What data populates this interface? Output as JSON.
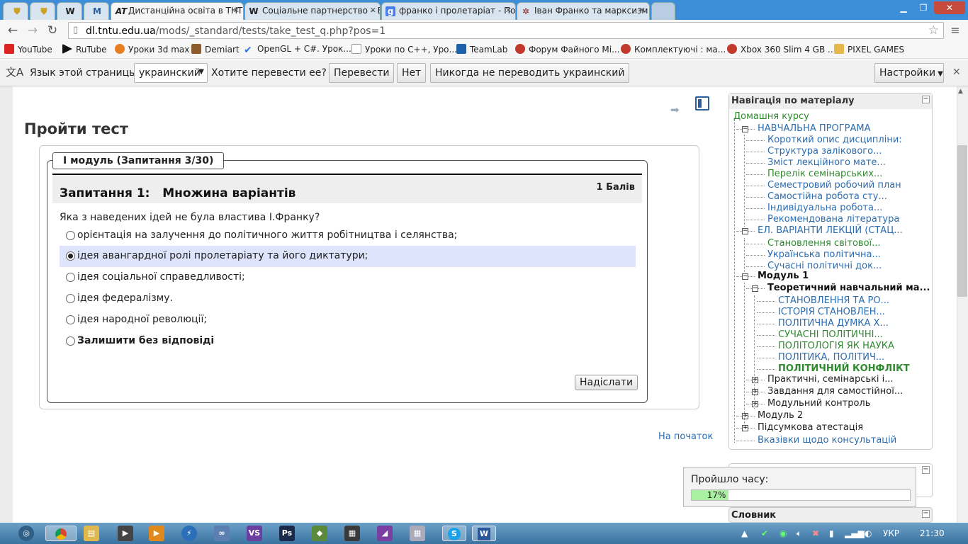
{
  "tabs": [
    {
      "title": "",
      "icon": "shield-icon"
    },
    {
      "title": "",
      "icon": "shield-icon"
    },
    {
      "title": "",
      "icon": "wikipedia-icon",
      "glyph": "W"
    },
    {
      "title": "",
      "icon": "moodle-icon",
      "glyph": "M"
    },
    {
      "title": "Дистанційна освіта в ТНТ",
      "icon": "at-icon",
      "glyph": "AT"
    },
    {
      "title": "Соціальне партнерство – Вік",
      "icon": "wikipedia-icon",
      "glyph": "W"
    },
    {
      "title": "франко і пролетаріат - Пошу",
      "icon": "google-icon",
      "glyph": "g"
    },
    {
      "title": "Іван Франко та марксизм",
      "icon": "star-icon",
      "glyph": "✲"
    }
  ],
  "address": {
    "domain": "dl.tntu.edu.ua",
    "path": "/mods/_standard/tests/take_test_q.php?pos=1"
  },
  "bookmarks": [
    {
      "label": "YouTube",
      "color": "#d22"
    },
    {
      "label": "RuTube",
      "color": "#111"
    },
    {
      "label": "Уроки 3d max",
      "color": "#e67e22"
    },
    {
      "label": "Demiart",
      "color": "#8e5b2a"
    },
    {
      "label": "OpenGL + C#. Урок...",
      "color": "#2a7ae2"
    },
    {
      "label": "Уроки по С++, Уро...",
      "color": "#bbb"
    },
    {
      "label": "TeamLab",
      "color": "#1d5fa8"
    },
    {
      "label": "Форум Файного Мі...",
      "color": "#c0392b"
    },
    {
      "label": "Комплектуючі : ма...",
      "color": "#c0392b"
    },
    {
      "label": "Xbox 360 Slim 4 GB ...",
      "color": "#c0392b"
    },
    {
      "label": "PIXEL GAMES",
      "color": "#e6b84a"
    }
  ],
  "translate": {
    "lang_label": "Язык этой страницы",
    "lang_value": "украинский",
    "question": "Хотите перевести ее?",
    "translate_btn": "Перевести",
    "no_btn": "Нет",
    "never_btn": "Никогда не переводить украинский",
    "settings_btn": "Настройки"
  },
  "page": {
    "title": "Пройти тест",
    "back_to_top": "На початок"
  },
  "test": {
    "legend": "І модуль (Запитання 3/30)",
    "question_title": "Запитання 1:   Множина варіантів",
    "grade": "1 Балів",
    "question_text": "Яка з наведених ідей не була властива І.Франку?",
    "options": [
      {
        "label": "орієнтація на залучення до політичного життя робітництва і селянства;",
        "selected": false
      },
      {
        "label": "ідея авангардної ролі пролетаріату та його диктатури;",
        "selected": true
      },
      {
        "label": "ідея соціальної справедливості;",
        "selected": false
      },
      {
        "label": "ідея федералізму.",
        "selected": false
      },
      {
        "label": "ідея народної революції;",
        "selected": false
      },
      {
        "label": "Залишити без відповіді",
        "selected": false,
        "bold": true
      }
    ],
    "submit": "Надіслати"
  },
  "nav": {
    "title": "Навігація по матеріалу",
    "home": "Домашня курсу",
    "items": [
      {
        "label": "НАВЧАЛЬНА ПРОГРАМА",
        "style": "link"
      },
      {
        "label": "Короткий опис дисципліни:",
        "style": "link"
      },
      {
        "label": "Структура залікового...",
        "style": "link"
      },
      {
        "label": "Зміст лекційного мате...",
        "style": "link"
      },
      {
        "label": "Перелік семінарських...",
        "style": "green"
      },
      {
        "label": "Семестровий робочий план",
        "style": "link"
      },
      {
        "label": "Самостійна робота сту...",
        "style": "link"
      },
      {
        "label": "Індивідуальна робота...",
        "style": "link"
      },
      {
        "label": "Рекомендована література",
        "style": "link"
      },
      {
        "label": "ЕЛ. ВАРІАНТИ ЛЕКЦІЙ (СТАЦ...",
        "style": "link"
      },
      {
        "label": "Становлення світової...",
        "style": "green"
      },
      {
        "label": "Українська політична...",
        "style": "link"
      },
      {
        "label": "Сучасні політичні док...",
        "style": "link"
      },
      {
        "label": "Модуль 1",
        "style": "bold"
      },
      {
        "label": "Теоретичний навчальний ма...",
        "style": "bold"
      },
      {
        "label": "СТАНОВЛЕННЯ ТА РО...",
        "style": "link"
      },
      {
        "label": "ІСТОРІЯ СТАНОВЛЕН...",
        "style": "link"
      },
      {
        "label": "ПОЛІТИЧНА ДУМКА Х...",
        "style": "link"
      },
      {
        "label": "СУЧАСНІ ПОЛІТИЧНІ...",
        "style": "green"
      },
      {
        "label": "ПОЛІТОЛОГІЯ ЯК НАУКА",
        "style": "green"
      },
      {
        "label": "ПОЛІТИКА, ПОЛІТИЧ...",
        "style": "link"
      },
      {
        "label": "ПОЛІТИЧНИЙ КОНФЛІКТ",
        "style": "cur"
      },
      {
        "label": "Практичні, семінарські і...",
        "style": "plain"
      },
      {
        "label": "Завдання для самостійної...",
        "style": "plain"
      },
      {
        "label": "Модульний контроль",
        "style": "plain"
      },
      {
        "label": "Модуль 2",
        "style": "plain"
      },
      {
        "label": "Підсумкова атестація",
        "style": "plain"
      },
      {
        "label": "Вказівки щодо консультацій",
        "style": "link"
      }
    ]
  },
  "slovnyk": "Словник",
  "timer": {
    "label": "Пройшло часу:",
    "progress_text": "17%",
    "progress": 0.17
  },
  "taskbar": {
    "lang": "УКР",
    "time": "21:30"
  }
}
